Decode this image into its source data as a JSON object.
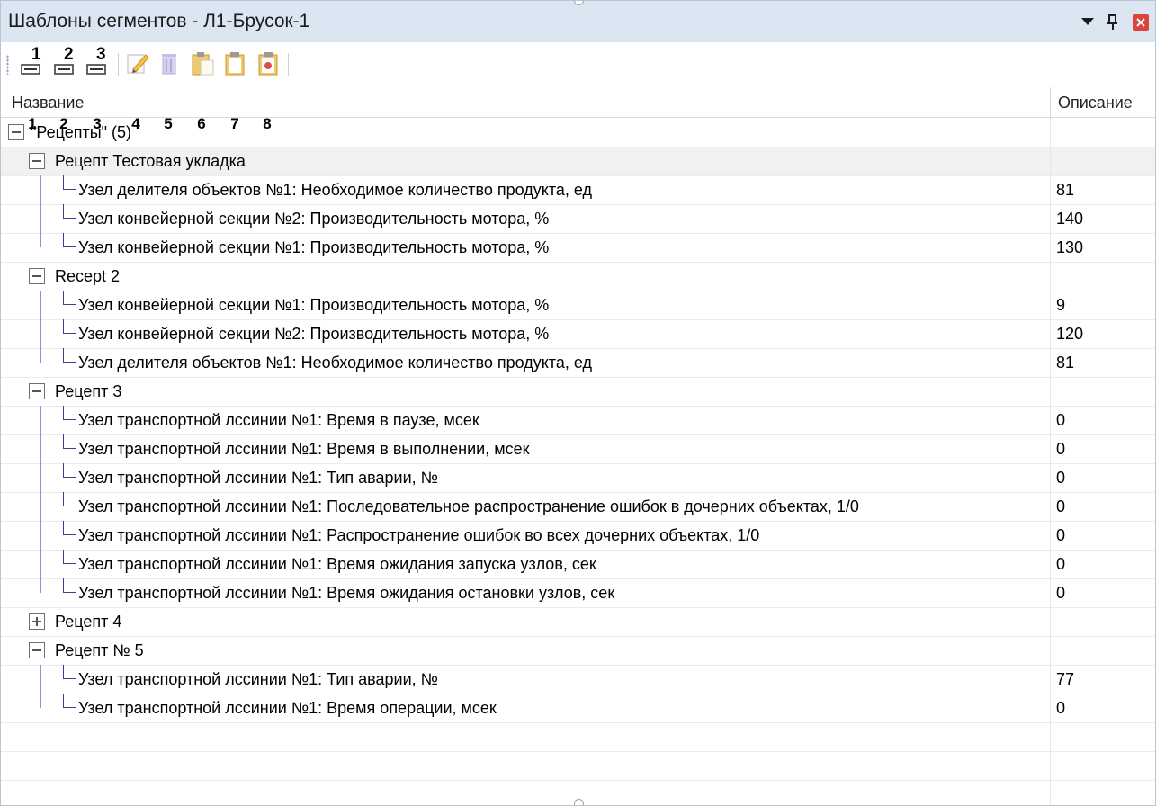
{
  "window": {
    "title": "Шаблоны сегментов - Л1-Брусок-1"
  },
  "toolbar": {
    "tools": [
      {
        "name": "expand-level-1",
        "badge": "1",
        "number": "1"
      },
      {
        "name": "expand-level-2",
        "badge": "2",
        "number": "2"
      },
      {
        "name": "expand-level-3",
        "badge": "3",
        "number": "3"
      },
      {
        "name": "edit",
        "number": "4"
      },
      {
        "name": "delete",
        "number": "5"
      },
      {
        "name": "paste",
        "number": "6"
      },
      {
        "name": "clipboard",
        "number": "7"
      },
      {
        "name": "clipboard-special",
        "number": "8"
      }
    ]
  },
  "grid": {
    "columns": [
      "Название",
      "Описание"
    ],
    "root": {
      "label": "\"Рецепты\" (5)"
    },
    "recipes": [
      {
        "label": "Рецепт Тестовая укладка",
        "expanded": true,
        "items": [
          {
            "name": "Узел делителя объектов №1: Необходимое количество продукта, ед",
            "value": "81"
          },
          {
            "name": "Узел конвейерной секции №2: Производительность мотора, %",
            "value": "140"
          },
          {
            "name": "Узел конвейерной секции №1: Производительность мотора, %",
            "value": "130"
          }
        ]
      },
      {
        "label": "Recept 2",
        "expanded": true,
        "items": [
          {
            "name": "Узел конвейерной секции №1: Производительность мотора, %",
            "value": "9"
          },
          {
            "name": "Узел конвейерной секции №2: Производительность мотора, %",
            "value": "120"
          },
          {
            "name": "Узел делителя объектов №1: Необходимое количество продукта, ед",
            "value": "81"
          }
        ]
      },
      {
        "label": "Рецепт 3",
        "expanded": true,
        "items": [
          {
            "name": "Узел транспортной лссинии №1: Время в паузе, мсек",
            "value": "0"
          },
          {
            "name": "Узел транспортной лссинии №1: Время в выполнении, мсек",
            "value": "0"
          },
          {
            "name": "Узел транспортной лссинии №1: Тип аварии, №",
            "value": "0"
          },
          {
            "name": "Узел транспортной лссинии №1: Последовательное распространение ошибок в дочерних объектах, 1/0",
            "value": "0"
          },
          {
            "name": "Узел транспортной лссинии №1: Распространение ошибок во всех дочерних объектах, 1/0",
            "value": "0"
          },
          {
            "name": "Узел транспортной лссинии №1: Время ожидания запуска узлов, сек",
            "value": "0"
          },
          {
            "name": "Узел транспортной лссинии №1: Время ожидания остановки узлов, сек",
            "value": "0"
          }
        ]
      },
      {
        "label": "Рецепт 4",
        "expanded": false,
        "items": []
      },
      {
        "label": "Рецепт № 5",
        "expanded": true,
        "items": [
          {
            "name": "Узел транспортной лссинии №1: Тип аварии, №",
            "value": "77"
          },
          {
            "name": "Узел транспортной лссинии №1: Время операции, мсек",
            "value": "0"
          }
        ]
      }
    ]
  },
  "colors": {
    "titlebar": "#dce6f3",
    "selected_row": "#f1f1f1",
    "tree_line": "#3d3d9c"
  }
}
